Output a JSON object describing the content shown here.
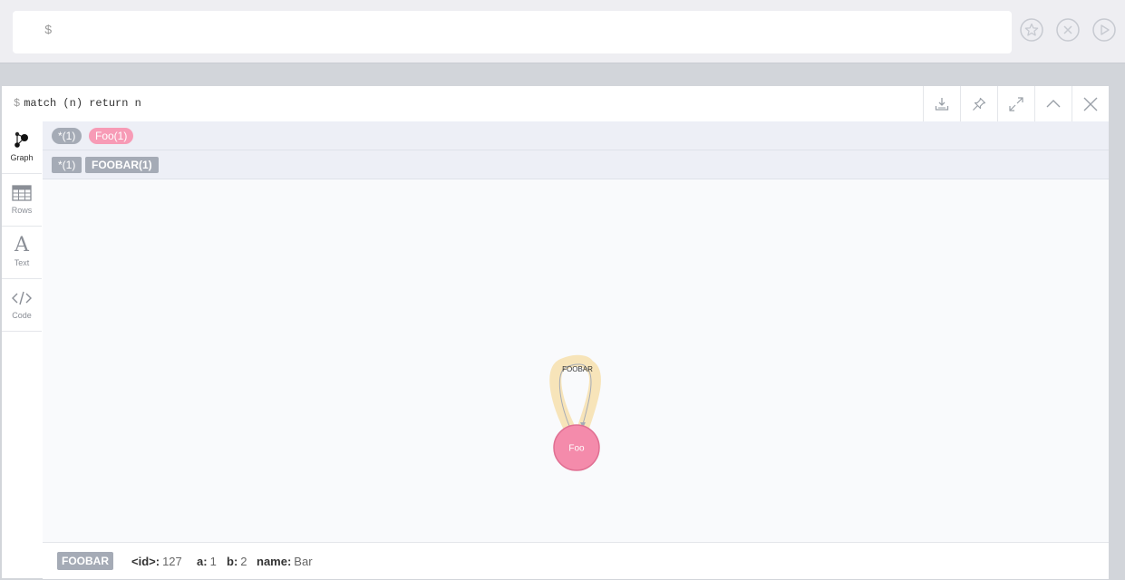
{
  "editor": {
    "prompt": "$",
    "buttons": [
      "favorite",
      "clear",
      "run"
    ]
  },
  "frame": {
    "prompt": "$",
    "query": "match (n) return n",
    "header_buttons": [
      "download",
      "pin",
      "fullscreen",
      "collapse",
      "close"
    ]
  },
  "sidebar": {
    "items": [
      {
        "label": "Graph",
        "icon": "graph-icon",
        "active": true
      },
      {
        "label": "Rows",
        "icon": "table-icon",
        "active": false
      },
      {
        "label": "Text",
        "icon": "text-icon",
        "active": false
      },
      {
        "label": "Code",
        "icon": "code-icon",
        "active": false
      }
    ]
  },
  "legend": {
    "labels": [
      {
        "text": "*(1)",
        "color": "#a5abb6"
      },
      {
        "text": "Foo(1)",
        "color": "#f79bb6"
      }
    ],
    "relationships": [
      {
        "text": "*(1)",
        "color": "#a5abb6"
      },
      {
        "text": "FOOBAR(1)",
        "color": "#a5abb6"
      }
    ]
  },
  "graph": {
    "node": {
      "caption": "Foo",
      "fill": "#f48bab",
      "stroke": "#e06f92"
    },
    "relationship": {
      "caption": "FOOBAR",
      "highlight": "#f7e4b9"
    }
  },
  "inspector": {
    "type_badge": "FOOBAR",
    "properties": [
      {
        "key": "<id>:",
        "value": "127"
      },
      {
        "key": "a:",
        "value": "1"
      },
      {
        "key": "b:",
        "value": "2"
      },
      {
        "key": "name:",
        "value": "Bar"
      }
    ]
  }
}
